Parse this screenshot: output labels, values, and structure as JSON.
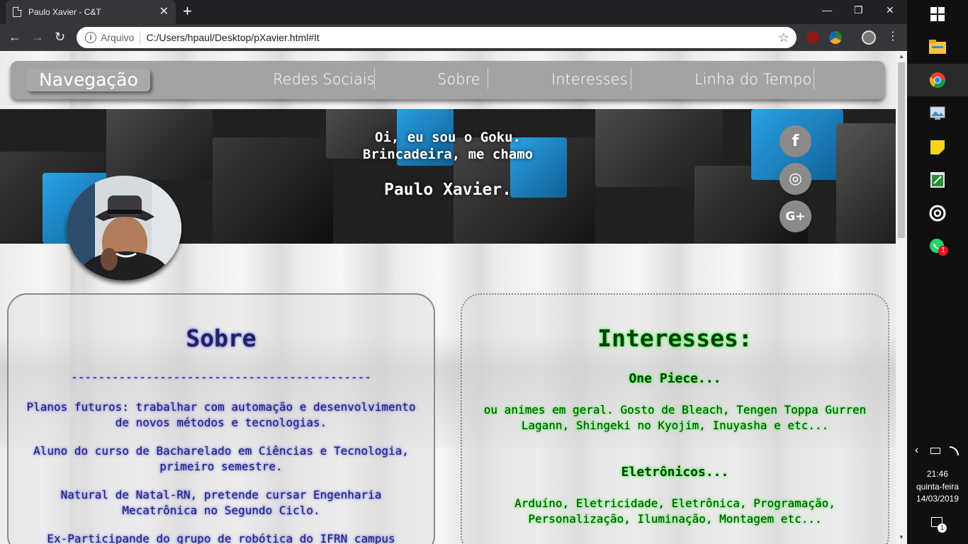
{
  "browser": {
    "tab_title": "Paulo Xavier - C&T",
    "tab_close": "✕",
    "new_tab": "+",
    "back": "←",
    "forward": "→",
    "reload": "↻",
    "address_label": "Arquivo",
    "address_url": "C:/Users/hpaul/Desktop/pXavier.html#It",
    "star": "☆",
    "minimize": "—",
    "restore": "❐",
    "close": "✕",
    "menu": "⋮"
  },
  "nav": {
    "brand": "Navegação",
    "links": [
      "Redes Sociais",
      "Sobre",
      "Interesses",
      "Linha do Tempo"
    ]
  },
  "hero": {
    "line1": "Oi, eu sou o Goku.",
    "line2": "Brincadeira, me chamo",
    "name": "Paulo Xavier.",
    "social": {
      "facebook": "f",
      "instagram": "◎",
      "google_plus": "G+"
    }
  },
  "sobre": {
    "title": "Sobre",
    "divider": "--------------------------------------------",
    "p1": "Planos futuros: trabalhar com automação e desenvolvimento de novos métodos e tecnologias.",
    "p2": "Aluno do curso de Bacharelado em Ciências e Tecnologia, primeiro semestre.",
    "p3": "Natural de Natal-RN, pretende cursar Engenharia Mecatrônica no Segundo Ciclo.",
    "p4": "Ex-Participande do grupo de robótica do IFRN campus"
  },
  "interesses": {
    "title": "Interesses:",
    "h1": "One Piece...",
    "p1": "ou animes em geral. Gosto de Bleach, Tengen Toppa Gurren Lagann, Shingeki no Kyojim, Inuyasha e etc...",
    "h2": "Eletrônicos...",
    "p2": "Arduíno, Eletricidade, Eletrônica, Programação, Personalização, Iluminação, Montagem etc..."
  },
  "taskbar": {
    "time": "21:46",
    "day": "quinta-feira",
    "date": "14/03/2019",
    "whatsapp_badge": "1",
    "notification_badge": "1",
    "chevron": "‹"
  },
  "colors": {
    "navbar": "#a3a3a3",
    "sobre_glow": "#6e6eff",
    "interesses_glow": "#30ff30",
    "hero_cube_blue": "#1f8fd0"
  }
}
